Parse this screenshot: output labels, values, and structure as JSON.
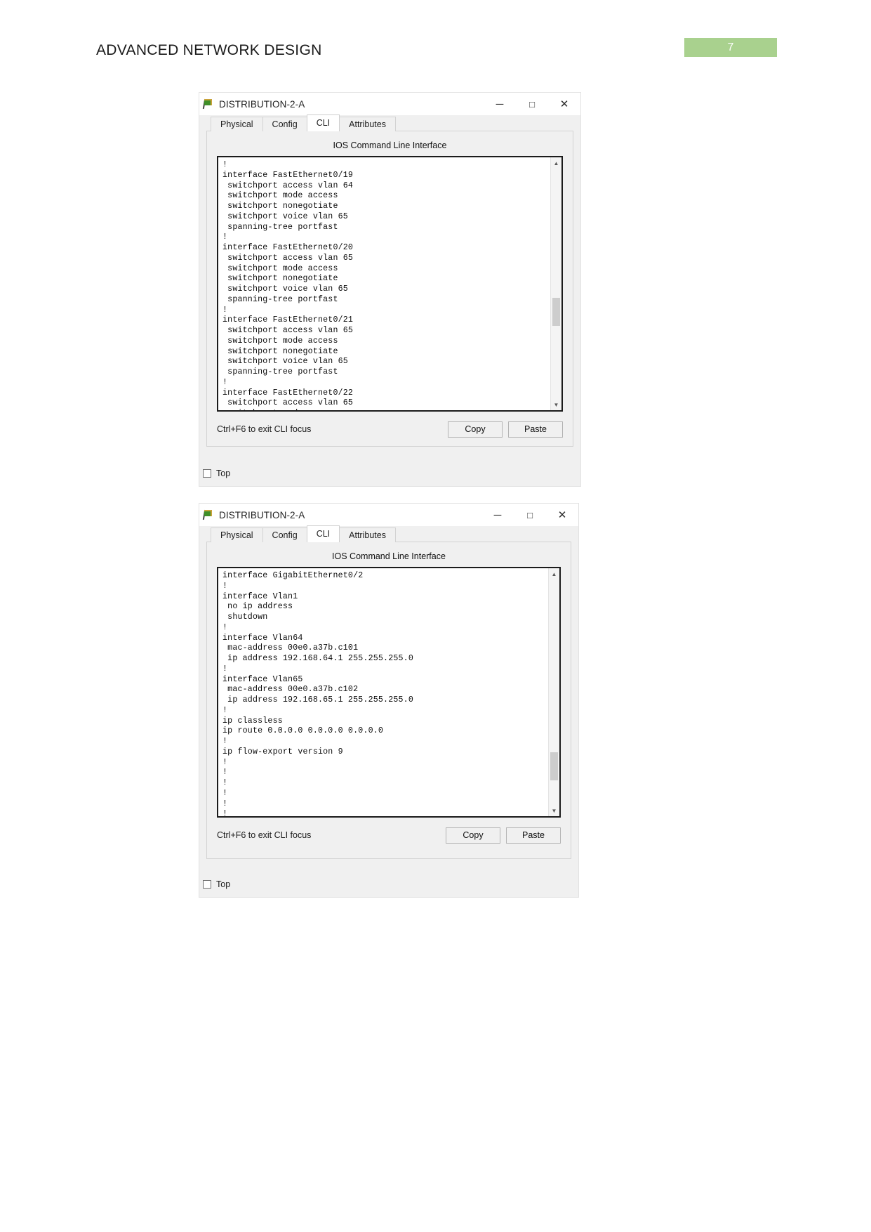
{
  "document": {
    "header_title": "ADVANCED NETWORK DESIGN",
    "page_number": "7",
    "page_badge_color": "#a9d18e"
  },
  "windows": [
    {
      "title": "DISTRIBUTION-2-A",
      "icon": "packet-tracer-flag-icon",
      "controls": {
        "minimize": "─",
        "maximize": "□",
        "close": "✕"
      },
      "tabs": [
        {
          "label": "Physical",
          "active": false
        },
        {
          "label": "Config",
          "active": false
        },
        {
          "label": "CLI",
          "active": true
        },
        {
          "label": "Attributes",
          "active": false
        }
      ],
      "cli_heading": "IOS Command Line Interface",
      "cli_lines": [
        "!",
        "interface FastEthernet0/19",
        " switchport access vlan 64",
        " switchport mode access",
        " switchport nonegotiate",
        " switchport voice vlan 65",
        " spanning-tree portfast",
        "!",
        "interface FastEthernet0/20",
        " switchport access vlan 65",
        " switchport mode access",
        " switchport nonegotiate",
        " switchport voice vlan 65",
        " spanning-tree portfast",
        "!",
        "interface FastEthernet0/21",
        " switchport access vlan 65",
        " switchport mode access",
        " switchport nonegotiate",
        " switchport voice vlan 65",
        " spanning-tree portfast",
        "!",
        "interface FastEthernet0/22",
        " switchport access vlan 65",
        " switchport mode access"
      ],
      "focus_hint": "Ctrl+F6 to exit CLI focus",
      "copy_label": "Copy",
      "paste_label": "Paste",
      "top_checkbox_label": "Top",
      "top_checkbox_checked": false
    },
    {
      "title": "DISTRIBUTION-2-A",
      "icon": "packet-tracer-flag-icon",
      "controls": {
        "minimize": "─",
        "maximize": "□",
        "close": "✕"
      },
      "tabs": [
        {
          "label": "Physical",
          "active": false
        },
        {
          "label": "Config",
          "active": false
        },
        {
          "label": "CLI",
          "active": true
        },
        {
          "label": "Attributes",
          "active": false
        }
      ],
      "cli_heading": "IOS Command Line Interface",
      "cli_lines": [
        "interface GigabitEthernet0/2",
        "!",
        "interface Vlan1",
        " no ip address",
        " shutdown",
        "!",
        "interface Vlan64",
        " mac-address 00e0.a37b.c101",
        " ip address 192.168.64.1 255.255.255.0",
        "!",
        "interface Vlan65",
        " mac-address 00e0.a37b.c102",
        " ip address 192.168.65.1 255.255.255.0",
        "!",
        "ip classless",
        "ip route 0.0.0.0 0.0.0.0 0.0.0.0",
        "!",
        "ip flow-export version 9",
        "!",
        "!",
        "!",
        "!",
        "!",
        "!",
        "!"
      ],
      "focus_hint": "Ctrl+F6 to exit CLI focus",
      "copy_label": "Copy",
      "paste_label": "Paste",
      "top_checkbox_label": "Top",
      "top_checkbox_checked": false
    }
  ]
}
